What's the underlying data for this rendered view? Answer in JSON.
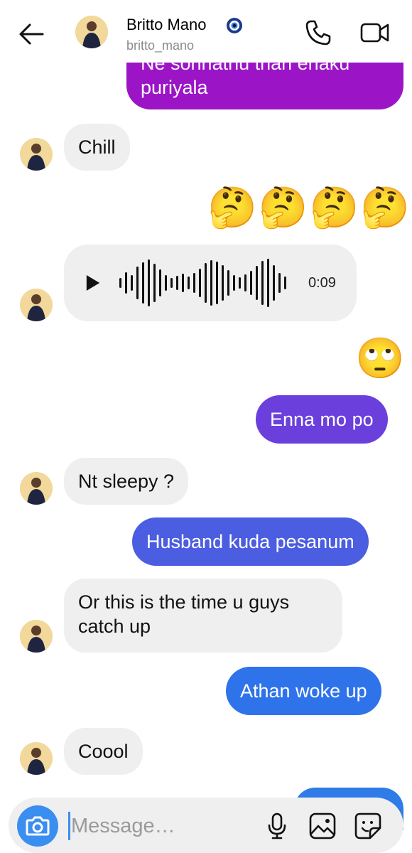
{
  "header": {
    "name": "Britto Mano",
    "handle": "britto_mano",
    "icons": [
      "back-arrow-icon",
      "verified-badge-icon",
      "phone-icon",
      "video-camera-icon"
    ]
  },
  "messages": [
    {
      "from": "me",
      "text_partial": "Ne sonnathu than enaku",
      "text": "puriyala",
      "color": "#9b15c6"
    },
    {
      "from": "them",
      "text": "Chill"
    },
    {
      "from": "me",
      "emoji": "🤔🤔🤔🤔"
    },
    {
      "from": "them",
      "type": "voice",
      "duration": "0:09"
    },
    {
      "from": "me",
      "emoji": "🙄"
    },
    {
      "from": "me",
      "text": "Enna mo po",
      "color": "#6a3fdc"
    },
    {
      "from": "them",
      "text": "Nt sleepy ?"
    },
    {
      "from": "me",
      "text": "Husband kuda pesanum",
      "color": "#4b5de0"
    },
    {
      "from": "them",
      "text": "Or this is the time u guys catch up",
      "lines": [
        "Or this is the time u guys",
        "catch up"
      ]
    },
    {
      "from": "me",
      "text": "Athan woke up",
      "color": "#2f73ea"
    },
    {
      "from": "them",
      "text": "Coool"
    }
  ],
  "composer": {
    "placeholder": "Message…",
    "icons": [
      "camera-icon",
      "microphone-icon",
      "gallery-icon",
      "sticker-icon"
    ]
  }
}
